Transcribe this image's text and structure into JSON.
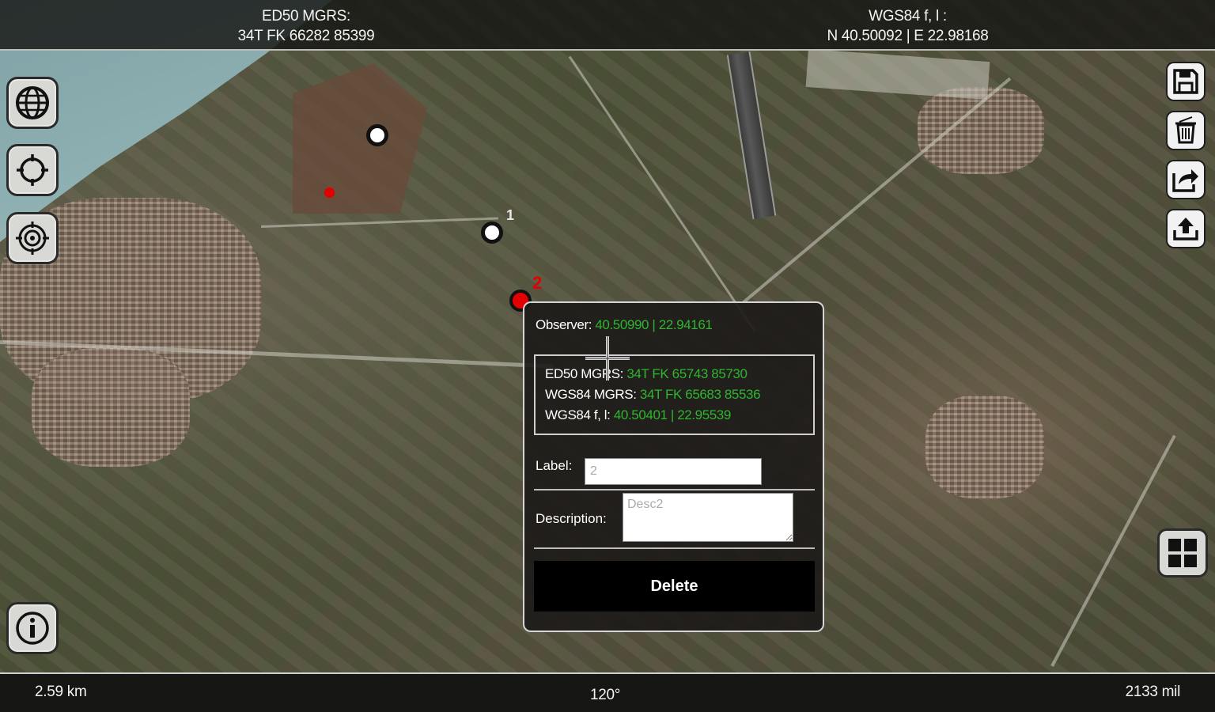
{
  "header": {
    "left_label": "ED50 MGRS:",
    "left_value": "34T FK 66282 85399",
    "right_label": "WGS84 f, l :",
    "right_value": "N 40.50092 | E 22.98168"
  },
  "footer": {
    "distance": "2.59 km",
    "bearing": "120°",
    "mils": "2133 mil"
  },
  "left_buttons": [
    {
      "icon": "globe-icon"
    },
    {
      "icon": "crosshair-icon"
    },
    {
      "icon": "target-icon"
    }
  ],
  "info_button": {
    "icon": "info-icon"
  },
  "right_buttons": [
    {
      "icon": "save-icon"
    },
    {
      "icon": "trash-icon"
    },
    {
      "icon": "share-icon"
    },
    {
      "icon": "upload-icon"
    }
  ],
  "grid_button": {
    "icon": "grid-icon"
  },
  "markers": {
    "label_1": "1",
    "label_2": "2"
  },
  "popup": {
    "observer_label": "Observer:",
    "observer_value": "40.50990 | 22.94161",
    "ed50_label": "ED50 MGRS:",
    "ed50_value": "34T FK 65743 85730",
    "wgs_mgrs_label": "WGS84 MGRS:",
    "wgs_mgrs_value": "34T FK 65683 85536",
    "wgs_fl_label": "WGS84 f, l:",
    "wgs_fl_value": "40.50401 | 22.95539",
    "label_field_label": "Label:",
    "label_field_value": "2",
    "description_label": "Description:",
    "description_value": "Desc2",
    "delete_label": "Delete"
  },
  "colors": {
    "accent_green": "#2fb52f",
    "marker_red": "#e30000"
  }
}
